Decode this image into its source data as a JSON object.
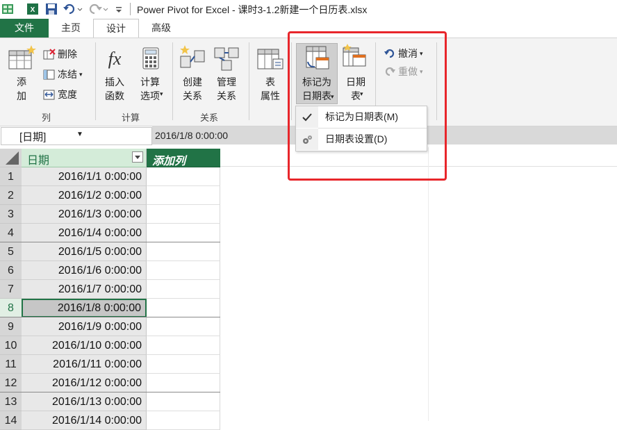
{
  "window": {
    "title": "Power Pivot for Excel - 课时3-1.2新建一个日历表.xlsx"
  },
  "tabs": [
    {
      "label": "文件"
    },
    {
      "label": "主页"
    },
    {
      "label": "设计"
    },
    {
      "label": "高级"
    }
  ],
  "ribbon": {
    "columns_group": {
      "label": "列",
      "add_label": "添\n加",
      "delete_label": "删除",
      "freeze_label": "冻结",
      "width_label": "宽度"
    },
    "calc_group": {
      "label": "计算",
      "insert_function_label": "插入\n函数",
      "calc_options_label": "计算\n选项"
    },
    "relations_group": {
      "label": "关系",
      "create_label": "创建\n关系",
      "manage_label": "管理\n关系"
    },
    "table_props_label": "表\n属性",
    "mark_date_label": "标记为\n日期表",
    "date_table_label": "日期\n表",
    "undo_label": "撤消",
    "redo_label": "重做"
  },
  "dropdown_menu": {
    "items": [
      {
        "label": "标记为日期表(M)",
        "key": "M"
      },
      {
        "label": "日期表设置(D)",
        "key": "D"
      }
    ]
  },
  "formula_bar": {
    "name_box": "[日期]",
    "value": "2016/1/8 0:00:00"
  },
  "grid": {
    "col_header": "日期",
    "add_column_header": "添加列",
    "selected_row": 8,
    "rows": [
      {
        "num": "1",
        "value": "2016/1/1 0:00:00"
      },
      {
        "num": "2",
        "value": "2016/1/2 0:00:00"
      },
      {
        "num": "3",
        "value": "2016/1/3 0:00:00"
      },
      {
        "num": "4",
        "value": "2016/1/4 0:00:00"
      },
      {
        "num": "5",
        "value": "2016/1/5 0:00:00"
      },
      {
        "num": "6",
        "value": "2016/1/6 0:00:00"
      },
      {
        "num": "7",
        "value": "2016/1/7 0:00:00"
      },
      {
        "num": "8",
        "value": "2016/1/8 0:00:00"
      },
      {
        "num": "9",
        "value": "2016/1/9 0:00:00"
      },
      {
        "num": "10",
        "value": "2016/1/10 0:00:00"
      },
      {
        "num": "11",
        "value": "2016/1/11 0:00:00"
      },
      {
        "num": "12",
        "value": "2016/1/12 0:00:00"
      },
      {
        "num": "13",
        "value": "2016/1/13 0:00:00"
      },
      {
        "num": "14",
        "value": "2016/1/14 0:00:00"
      }
    ]
  },
  "colors": {
    "brand_green": "#217346",
    "highlight_red": "#e8262b"
  }
}
